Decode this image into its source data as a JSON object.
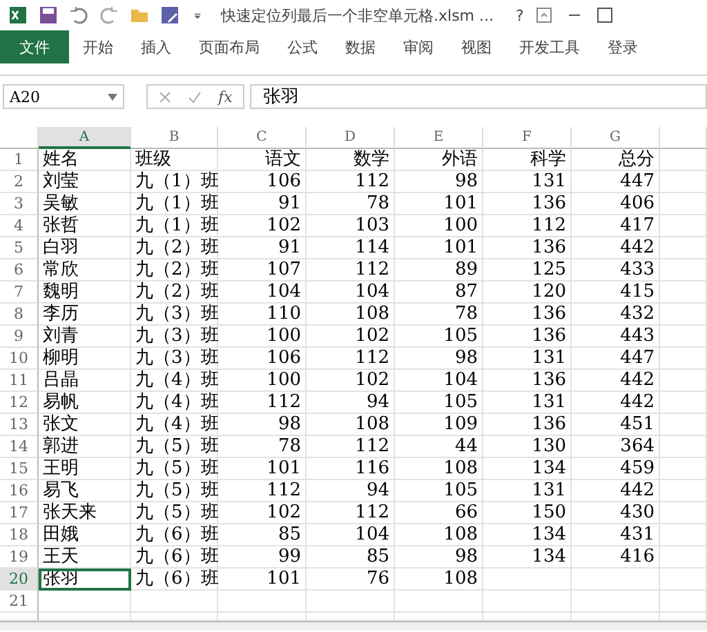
{
  "window": {
    "title": "快速定位列最后一个非空单元格.xlsm ...",
    "help": "?"
  },
  "ribbon_tabs": [
    {
      "label": "文件",
      "selected": true
    },
    {
      "label": "开始",
      "selected": false
    },
    {
      "label": "插入",
      "selected": false
    },
    {
      "label": "页面布局",
      "selected": false
    },
    {
      "label": "公式",
      "selected": false
    },
    {
      "label": "数据",
      "selected": false
    },
    {
      "label": "审阅",
      "selected": false
    },
    {
      "label": "视图",
      "selected": false
    },
    {
      "label": "开发工具",
      "selected": false
    },
    {
      "label": "登录",
      "selected": false
    }
  ],
  "formula_bar": {
    "name_box": "A20",
    "fx": "fx",
    "value": "张羽"
  },
  "columns": [
    {
      "label": "A",
      "selected": true,
      "numeric": false
    },
    {
      "label": "B",
      "selected": false,
      "numeric": false
    },
    {
      "label": "C",
      "selected": false,
      "numeric": true
    },
    {
      "label": "D",
      "selected": false,
      "numeric": true
    },
    {
      "label": "E",
      "selected": false,
      "numeric": true
    },
    {
      "label": "F",
      "selected": false,
      "numeric": true
    },
    {
      "label": "G",
      "selected": false,
      "numeric": true
    }
  ],
  "rows": [
    {
      "number": "1",
      "selected": false,
      "cells": [
        "姓名",
        "班级",
        "语文",
        "数学",
        "外语",
        "科学",
        "总分"
      ]
    },
    {
      "number": "2",
      "selected": false,
      "cells": [
        "刘莹",
        "九（1）班",
        "106",
        "112",
        "98",
        "131",
        "447"
      ]
    },
    {
      "number": "3",
      "selected": false,
      "cells": [
        "吴敏",
        "九（1）班",
        "91",
        "78",
        "101",
        "136",
        "406"
      ]
    },
    {
      "number": "4",
      "selected": false,
      "cells": [
        "张哲",
        "九（1）班",
        "102",
        "103",
        "100",
        "112",
        "417"
      ]
    },
    {
      "number": "5",
      "selected": false,
      "cells": [
        "白羽",
        "九（2）班",
        "91",
        "114",
        "101",
        "136",
        "442"
      ]
    },
    {
      "number": "6",
      "selected": false,
      "cells": [
        "常欣",
        "九（2）班",
        "107",
        "112",
        "89",
        "125",
        "433"
      ]
    },
    {
      "number": "7",
      "selected": false,
      "cells": [
        "魏明",
        "九（2）班",
        "104",
        "104",
        "87",
        "120",
        "415"
      ]
    },
    {
      "number": "8",
      "selected": false,
      "cells": [
        "李历",
        "九（3）班",
        "110",
        "108",
        "78",
        "136",
        "432"
      ]
    },
    {
      "number": "9",
      "selected": false,
      "cells": [
        "刘青",
        "九（3）班",
        "100",
        "102",
        "105",
        "136",
        "443"
      ]
    },
    {
      "number": "10",
      "selected": false,
      "cells": [
        "柳明",
        "九（3）班",
        "106",
        "112",
        "98",
        "131",
        "447"
      ]
    },
    {
      "number": "11",
      "selected": false,
      "cells": [
        "吕晶",
        "九（4）班",
        "100",
        "102",
        "104",
        "136",
        "442"
      ]
    },
    {
      "number": "12",
      "selected": false,
      "cells": [
        "易帆",
        "九（4）班",
        "112",
        "94",
        "105",
        "131",
        "442"
      ]
    },
    {
      "number": "13",
      "selected": false,
      "cells": [
        "张文",
        "九（4）班",
        "98",
        "108",
        "109",
        "136",
        "451"
      ]
    },
    {
      "number": "14",
      "selected": false,
      "cells": [
        "郭进",
        "九（5）班",
        "78",
        "112",
        "44",
        "130",
        "364"
      ]
    },
    {
      "number": "15",
      "selected": false,
      "cells": [
        "王明",
        "九（5）班",
        "101",
        "116",
        "108",
        "134",
        "459"
      ]
    },
    {
      "number": "16",
      "selected": false,
      "cells": [
        "易飞",
        "九（5）班",
        "112",
        "94",
        "105",
        "131",
        "442"
      ]
    },
    {
      "number": "17",
      "selected": false,
      "cells": [
        "张天来",
        "九（5）班",
        "102",
        "112",
        "66",
        "150",
        "430"
      ]
    },
    {
      "number": "18",
      "selected": false,
      "cells": [
        "田娥",
        "九（6）班",
        "85",
        "104",
        "108",
        "134",
        "431"
      ]
    },
    {
      "number": "19",
      "selected": false,
      "cells": [
        "王天",
        "九（6）班",
        "99",
        "85",
        "98",
        "134",
        "416"
      ]
    },
    {
      "number": "20",
      "selected": true,
      "cells": [
        "张羽",
        "九（6）班",
        "101",
        "76",
        "108",
        "",
        ""
      ]
    },
    {
      "number": "21",
      "selected": false,
      "cells": [
        "",
        "",
        "",
        "",
        "",
        "",
        ""
      ]
    }
  ]
}
